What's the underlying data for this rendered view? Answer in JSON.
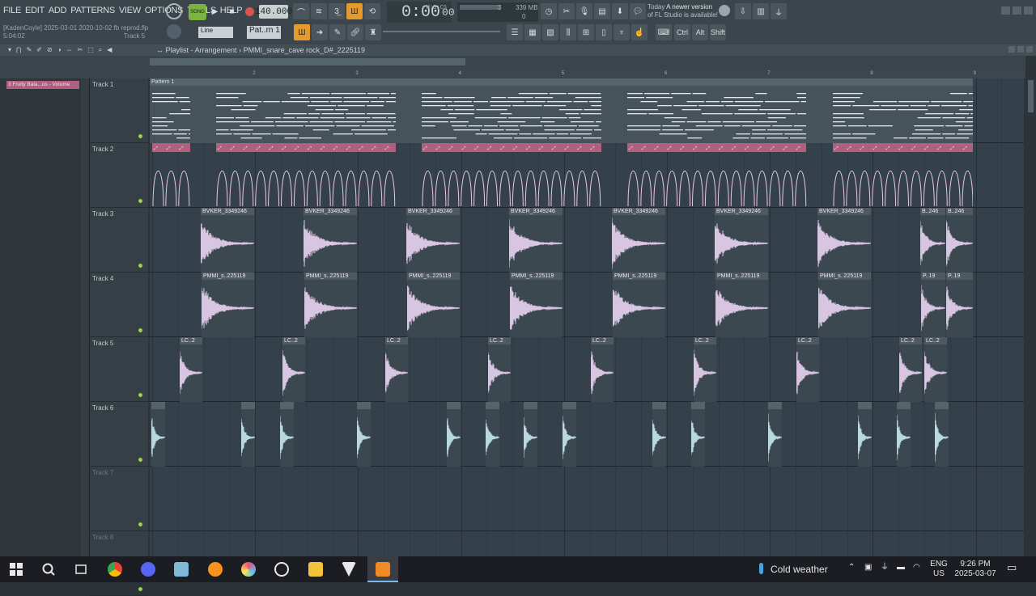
{
  "menu": [
    "FILE",
    "EDIT",
    "ADD",
    "PATTERNS",
    "VIEW",
    "OPTIONS",
    "TOOLS",
    "HELP"
  ],
  "project": {
    "line1": "[KadenCoyle] 2025-03-01 2020-10-02 fb reprod.flp",
    "line2": "5:04:02",
    "track_hint": "Track 5"
  },
  "transport": {
    "mode": "SONG",
    "tempo": "140.000",
    "time": "0:00",
    "time_small": "00",
    "time_label": "M:S:CS",
    "cpu_value": "3",
    "mem": "339 MB",
    "poly": "0"
  },
  "news": {
    "day": "Today",
    "text1": "A newer version",
    "text2": "of FL Studio is available!"
  },
  "snap": {
    "label": "Line"
  },
  "pattern": {
    "label": "Pat..rn 1"
  },
  "mod_keys": [
    "Ctrl",
    "Alt",
    "Shift"
  ],
  "playlist": {
    "title": "Playlist - Arrangement",
    "sep": "›",
    "name": "PMMI_snare_cave rock_D#_2225119",
    "browser_selected": "3 Fruity Bala...us - Volume"
  },
  "ruler": [
    "2",
    "3",
    "4",
    "5",
    "6",
    "7",
    "8",
    "9"
  ],
  "tracks": [
    {
      "name": "Track 1",
      "active": true
    },
    {
      "name": "Track 2",
      "active": true
    },
    {
      "name": "Track 3",
      "active": true
    },
    {
      "name": "Track 4",
      "active": true
    },
    {
      "name": "Track 5",
      "active": true
    },
    {
      "name": "Track 6",
      "active": true
    },
    {
      "name": "Track 7",
      "active": false
    },
    {
      "name": "Track 8",
      "active": false
    }
  ],
  "pattern_clip": "Pattern 1",
  "clips": {
    "t3": "BVKER_3349246",
    "t3_short": "B..246",
    "t4": "PMMI_s..225119",
    "t4_short": "P..19",
    "t5": "LC..2"
  },
  "taskbar": {
    "weather": "Cold weather",
    "lang1": "ENG",
    "lang2": "US",
    "time": "9:26 PM",
    "date": "2025-03-07"
  },
  "colors": {
    "accent": "#e59a2b",
    "automation": "#b05f7e",
    "clip_pink": "#e9c8dc",
    "audio_wave": "#d8c5e2",
    "t6_wave": "#b9d7e0"
  }
}
